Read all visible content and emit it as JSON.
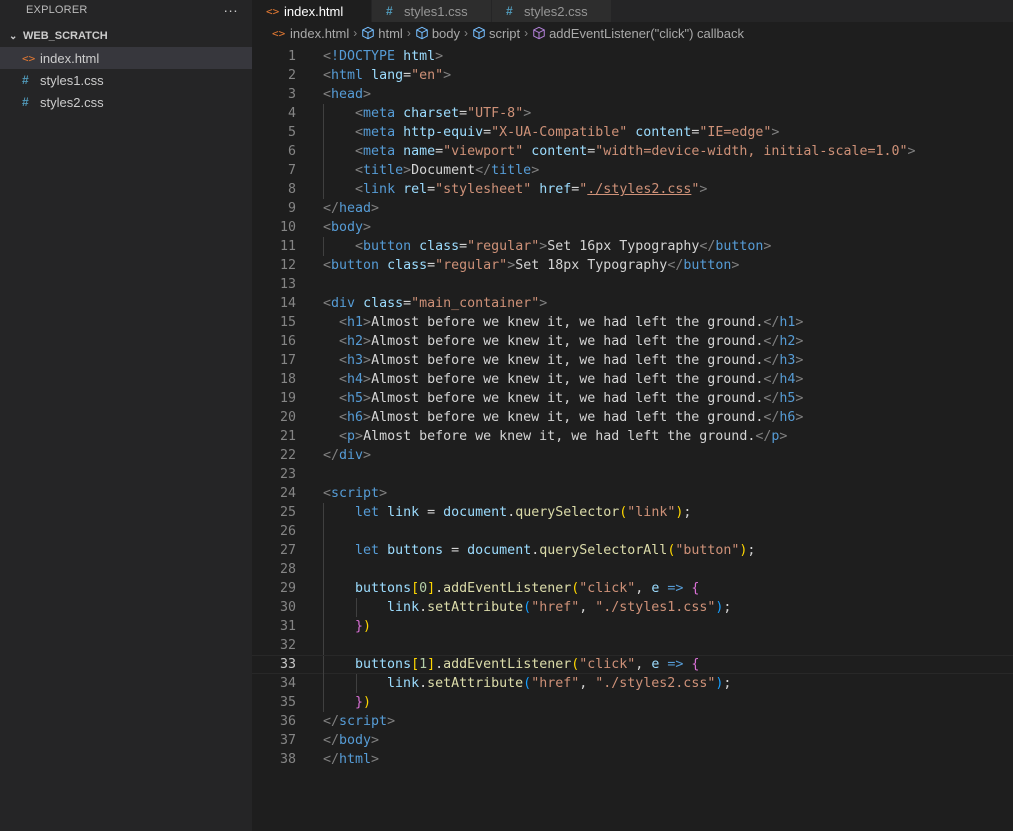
{
  "explorer": {
    "title": "EXPLORER",
    "more": "···",
    "folder": "WEB_SCRATCH",
    "files": [
      {
        "name": "index.html",
        "icon": "html-file-icon",
        "selected": true
      },
      {
        "name": "styles1.css",
        "icon": "css-file-icon",
        "selected": false
      },
      {
        "name": "styles2.css",
        "icon": "css-file-icon",
        "selected": false
      }
    ]
  },
  "tabs": [
    {
      "label": "index.html",
      "active": true,
      "icon": "html-file-icon"
    },
    {
      "label": "styles1.css",
      "active": false,
      "icon": "css-file-icon"
    },
    {
      "label": "styles2.css",
      "active": false,
      "icon": "css-file-icon"
    }
  ],
  "breadcrumbs": [
    "index.html",
    "html",
    "body",
    "script",
    "addEventListener(\"click\") callback"
  ],
  "colors": {
    "accent_html": "#e37933",
    "accent_css": "#519aba",
    "editor_bg": "#1e1e1e",
    "sidebar_bg": "#252526"
  },
  "editor": {
    "active_line": 33,
    "lines": [
      [
        [
          "t-pun",
          "<"
        ],
        [
          "t-tag",
          "!DOCTYPE"
        ],
        [
          "t-txt",
          " "
        ],
        [
          "t-attr",
          "html"
        ],
        [
          "t-pun",
          ">"
        ]
      ],
      [
        [
          "t-pun",
          "<"
        ],
        [
          "t-tag",
          "html"
        ],
        [
          "t-txt",
          " "
        ],
        [
          "t-attr",
          "lang"
        ],
        [
          "t-txt",
          "="
        ],
        [
          "t-str",
          "\"en\""
        ],
        [
          "t-pun",
          ">"
        ]
      ],
      [
        [
          "t-pun",
          "<"
        ],
        [
          "t-tag",
          "head"
        ],
        [
          "t-pun",
          ">"
        ]
      ],
      [
        [
          "t-txt",
          "    "
        ],
        [
          "t-pun",
          "<"
        ],
        [
          "t-tag",
          "meta"
        ],
        [
          "t-txt",
          " "
        ],
        [
          "t-attr",
          "charset"
        ],
        [
          "t-txt",
          "="
        ],
        [
          "t-str",
          "\"UTF-8\""
        ],
        [
          "t-pun",
          ">"
        ]
      ],
      [
        [
          "t-txt",
          "    "
        ],
        [
          "t-pun",
          "<"
        ],
        [
          "t-tag",
          "meta"
        ],
        [
          "t-txt",
          " "
        ],
        [
          "t-attr",
          "http-equiv"
        ],
        [
          "t-txt",
          "="
        ],
        [
          "t-str",
          "\"X-UA-Compatible\""
        ],
        [
          "t-txt",
          " "
        ],
        [
          "t-attr",
          "content"
        ],
        [
          "t-txt",
          "="
        ],
        [
          "t-str",
          "\"IE=edge\""
        ],
        [
          "t-pun",
          ">"
        ]
      ],
      [
        [
          "t-txt",
          "    "
        ],
        [
          "t-pun",
          "<"
        ],
        [
          "t-tag",
          "meta"
        ],
        [
          "t-txt",
          " "
        ],
        [
          "t-attr",
          "name"
        ],
        [
          "t-txt",
          "="
        ],
        [
          "t-str",
          "\"viewport\""
        ],
        [
          "t-txt",
          " "
        ],
        [
          "t-attr",
          "content"
        ],
        [
          "t-txt",
          "="
        ],
        [
          "t-str",
          "\"width=device-width, initial-scale=1.0\""
        ],
        [
          "t-pun",
          ">"
        ]
      ],
      [
        [
          "t-txt",
          "    "
        ],
        [
          "t-pun",
          "<"
        ],
        [
          "t-tag",
          "title"
        ],
        [
          "t-pun",
          ">"
        ],
        [
          "t-txt",
          "Document"
        ],
        [
          "t-pun",
          "</"
        ],
        [
          "t-tag",
          "title"
        ],
        [
          "t-pun",
          ">"
        ]
      ],
      [
        [
          "t-txt",
          "    "
        ],
        [
          "t-pun",
          "<"
        ],
        [
          "t-tag",
          "link"
        ],
        [
          "t-txt",
          " "
        ],
        [
          "t-attr",
          "rel"
        ],
        [
          "t-txt",
          "="
        ],
        [
          "t-str",
          "\"stylesheet\""
        ],
        [
          "t-txt",
          " "
        ],
        [
          "t-attr",
          "href"
        ],
        [
          "t-txt",
          "="
        ],
        [
          "t-str",
          "\""
        ],
        [
          "t-str t-link",
          "./styles2.css"
        ],
        [
          "t-str",
          "\""
        ],
        [
          "t-pun",
          ">"
        ]
      ],
      [
        [
          "t-pun",
          "</"
        ],
        [
          "t-tag",
          "head"
        ],
        [
          "t-pun",
          ">"
        ]
      ],
      [
        [
          "t-pun",
          "<"
        ],
        [
          "t-tag",
          "body"
        ],
        [
          "t-pun",
          ">"
        ]
      ],
      [
        [
          "t-txt",
          "    "
        ],
        [
          "t-pun",
          "<"
        ],
        [
          "t-tag",
          "button"
        ],
        [
          "t-txt",
          " "
        ],
        [
          "t-attr",
          "class"
        ],
        [
          "t-txt",
          "="
        ],
        [
          "t-str",
          "\"regular\""
        ],
        [
          "t-pun",
          ">"
        ],
        [
          "t-txt",
          "Set 16px Typography"
        ],
        [
          "t-pun",
          "</"
        ],
        [
          "t-tag",
          "button"
        ],
        [
          "t-pun",
          ">"
        ]
      ],
      [
        [
          "t-pun",
          "<"
        ],
        [
          "t-tag",
          "button"
        ],
        [
          "t-txt",
          " "
        ],
        [
          "t-attr",
          "class"
        ],
        [
          "t-txt",
          "="
        ],
        [
          "t-str",
          "\"regular\""
        ],
        [
          "t-pun",
          ">"
        ],
        [
          "t-txt",
          "Set 18px Typography"
        ],
        [
          "t-pun",
          "</"
        ],
        [
          "t-tag",
          "button"
        ],
        [
          "t-pun",
          ">"
        ]
      ],
      [],
      [
        [
          "t-pun",
          "<"
        ],
        [
          "t-tag",
          "div"
        ],
        [
          "t-txt",
          " "
        ],
        [
          "t-attr",
          "class"
        ],
        [
          "t-txt",
          "="
        ],
        [
          "t-str",
          "\"main_container\""
        ],
        [
          "t-pun",
          ">"
        ]
      ],
      [
        [
          "t-txt",
          "  "
        ],
        [
          "t-pun",
          "<"
        ],
        [
          "t-tag",
          "h1"
        ],
        [
          "t-pun",
          ">"
        ],
        [
          "t-txt",
          "Almost before we knew it, we had left the ground."
        ],
        [
          "t-pun",
          "</"
        ],
        [
          "t-tag",
          "h1"
        ],
        [
          "t-pun",
          ">"
        ]
      ],
      [
        [
          "t-txt",
          "  "
        ],
        [
          "t-pun",
          "<"
        ],
        [
          "t-tag",
          "h2"
        ],
        [
          "t-pun",
          ">"
        ],
        [
          "t-txt",
          "Almost before we knew it, we had left the ground."
        ],
        [
          "t-pun",
          "</"
        ],
        [
          "t-tag",
          "h2"
        ],
        [
          "t-pun",
          ">"
        ]
      ],
      [
        [
          "t-txt",
          "  "
        ],
        [
          "t-pun",
          "<"
        ],
        [
          "t-tag",
          "h3"
        ],
        [
          "t-pun",
          ">"
        ],
        [
          "t-txt",
          "Almost before we knew it, we had left the ground."
        ],
        [
          "t-pun",
          "</"
        ],
        [
          "t-tag",
          "h3"
        ],
        [
          "t-pun",
          ">"
        ]
      ],
      [
        [
          "t-txt",
          "  "
        ],
        [
          "t-pun",
          "<"
        ],
        [
          "t-tag",
          "h4"
        ],
        [
          "t-pun",
          ">"
        ],
        [
          "t-txt",
          "Almost before we knew it, we had left the ground."
        ],
        [
          "t-pun",
          "</"
        ],
        [
          "t-tag",
          "h4"
        ],
        [
          "t-pun",
          ">"
        ]
      ],
      [
        [
          "t-txt",
          "  "
        ],
        [
          "t-pun",
          "<"
        ],
        [
          "t-tag",
          "h5"
        ],
        [
          "t-pun",
          ">"
        ],
        [
          "t-txt",
          "Almost before we knew it, we had left the ground."
        ],
        [
          "t-pun",
          "</"
        ],
        [
          "t-tag",
          "h5"
        ],
        [
          "t-pun",
          ">"
        ]
      ],
      [
        [
          "t-txt",
          "  "
        ],
        [
          "t-pun",
          "<"
        ],
        [
          "t-tag",
          "h6"
        ],
        [
          "t-pun",
          ">"
        ],
        [
          "t-txt",
          "Almost before we knew it, we had left the ground."
        ],
        [
          "t-pun",
          "</"
        ],
        [
          "t-tag",
          "h6"
        ],
        [
          "t-pun",
          ">"
        ]
      ],
      [
        [
          "t-txt",
          "  "
        ],
        [
          "t-pun",
          "<"
        ],
        [
          "t-tag",
          "p"
        ],
        [
          "t-pun",
          ">"
        ],
        [
          "t-txt",
          "Almost before we knew it, we had left the ground."
        ],
        [
          "t-pun",
          "</"
        ],
        [
          "t-tag",
          "p"
        ],
        [
          "t-pun",
          ">"
        ]
      ],
      [
        [
          "t-pun",
          "</"
        ],
        [
          "t-tag",
          "div"
        ],
        [
          "t-pun",
          ">"
        ]
      ],
      [],
      [
        [
          "t-pun",
          "<"
        ],
        [
          "t-tag",
          "script"
        ],
        [
          "t-pun",
          ">"
        ]
      ],
      [
        [
          "t-txt",
          "    "
        ],
        [
          "t-kw",
          "let"
        ],
        [
          "t-txt",
          " "
        ],
        [
          "t-var",
          "link"
        ],
        [
          "t-txt",
          " = "
        ],
        [
          "t-var",
          "document"
        ],
        [
          "t-txt",
          "."
        ],
        [
          "t-fn",
          "querySelector"
        ],
        [
          "t-br1",
          "("
        ],
        [
          "t-str",
          "\"link\""
        ],
        [
          "t-br1",
          ")"
        ],
        [
          "t-txt",
          ";"
        ]
      ],
      [],
      [
        [
          "t-txt",
          "    "
        ],
        [
          "t-kw",
          "let"
        ],
        [
          "t-txt",
          " "
        ],
        [
          "t-var",
          "buttons"
        ],
        [
          "t-txt",
          " = "
        ],
        [
          "t-var",
          "document"
        ],
        [
          "t-txt",
          "."
        ],
        [
          "t-fn",
          "querySelectorAll"
        ],
        [
          "t-br1",
          "("
        ],
        [
          "t-str",
          "\"button\""
        ],
        [
          "t-br1",
          ")"
        ],
        [
          "t-txt",
          ";"
        ]
      ],
      [],
      [
        [
          "t-txt",
          "    "
        ],
        [
          "t-var",
          "buttons"
        ],
        [
          "t-br1",
          "["
        ],
        [
          "t-num",
          "0"
        ],
        [
          "t-br1",
          "]"
        ],
        [
          "t-txt",
          "."
        ],
        [
          "t-fn",
          "addEventListener"
        ],
        [
          "t-br1",
          "("
        ],
        [
          "t-str",
          "\"click\""
        ],
        [
          "t-txt",
          ", "
        ],
        [
          "t-var",
          "e"
        ],
        [
          "t-txt",
          " "
        ],
        [
          "t-kw",
          "=>"
        ],
        [
          "t-txt",
          " "
        ],
        [
          "t-br2",
          "{"
        ]
      ],
      [
        [
          "t-txt",
          "        "
        ],
        [
          "t-var",
          "link"
        ],
        [
          "t-txt",
          "."
        ],
        [
          "t-fn",
          "setAttribute"
        ],
        [
          "t-br3",
          "("
        ],
        [
          "t-str",
          "\"href\""
        ],
        [
          "t-txt",
          ", "
        ],
        [
          "t-str",
          "\"./styles1.css\""
        ],
        [
          "t-br3",
          ")"
        ],
        [
          "t-txt",
          ";"
        ]
      ],
      [
        [
          "t-txt",
          "    "
        ],
        [
          "t-br2",
          "}"
        ],
        [
          "t-br1",
          ")"
        ]
      ],
      [],
      [
        [
          "t-txt",
          "    "
        ],
        [
          "t-var",
          "buttons"
        ],
        [
          "t-br1",
          "["
        ],
        [
          "t-num",
          "1"
        ],
        [
          "t-br1",
          "]"
        ],
        [
          "t-txt",
          "."
        ],
        [
          "t-fn",
          "addEventListener"
        ],
        [
          "t-br1",
          "("
        ],
        [
          "t-str",
          "\"click\""
        ],
        [
          "t-txt",
          ", "
        ],
        [
          "t-var",
          "e"
        ],
        [
          "t-txt",
          " "
        ],
        [
          "t-kw",
          "=>"
        ],
        [
          "t-txt",
          " "
        ],
        [
          "t-br2",
          "{"
        ]
      ],
      [
        [
          "t-txt",
          "        "
        ],
        [
          "t-var",
          "link"
        ],
        [
          "t-txt",
          "."
        ],
        [
          "t-fn",
          "setAttribute"
        ],
        [
          "t-br3",
          "("
        ],
        [
          "t-str",
          "\"href\""
        ],
        [
          "t-txt",
          ", "
        ],
        [
          "t-str",
          "\"./styles2.css\""
        ],
        [
          "t-br3",
          ")"
        ],
        [
          "t-txt",
          ";"
        ]
      ],
      [
        [
          "t-txt",
          "    "
        ],
        [
          "t-br2",
          "}"
        ],
        [
          "t-br1",
          ")"
        ]
      ],
      [
        [
          "t-pun",
          "</"
        ],
        [
          "t-tag",
          "script"
        ],
        [
          "t-pun",
          ">"
        ]
      ],
      [
        [
          "t-pun",
          "</"
        ],
        [
          "t-tag",
          "body"
        ],
        [
          "t-pun",
          ">"
        ]
      ],
      [
        [
          "t-pun",
          "</"
        ],
        [
          "t-tag",
          "html"
        ],
        [
          "t-pun",
          ">"
        ]
      ]
    ]
  }
}
